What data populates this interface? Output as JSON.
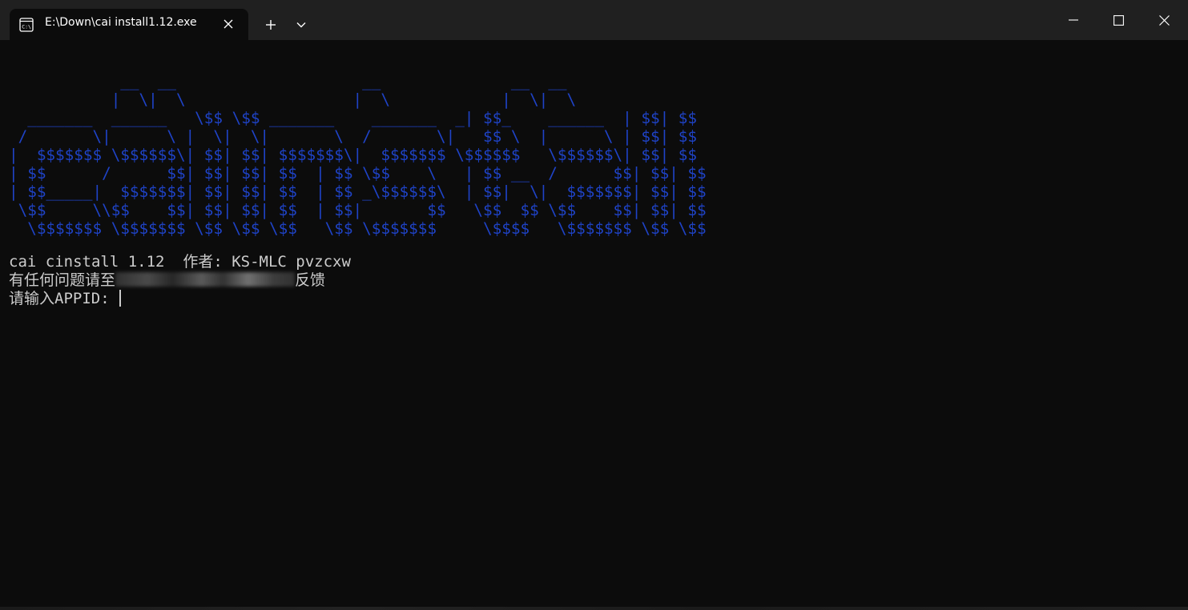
{
  "window": {
    "tab_title": "E:\\Down\\cai install1.12.exe",
    "tab_icon": "terminal-icon",
    "controls": {
      "new_tab": "plus-icon",
      "dropdown": "chevron-down-icon",
      "minimize": "minimize-icon",
      "maximize": "maximize-icon",
      "close": "close-icon"
    }
  },
  "terminal": {
    "banner_color": "#1f43c7",
    "text_color": "#cccccc",
    "background": "#0c0c0c",
    "banner_ascii": "            __  __                    __              __  __\n           |  \\|  \\                  |  \\            |  \\|  \\\n  _______  ______   \\$$ \\$$ _______    _______  _| $$_    ______  | $$| $$\n /       \\|      \\ |  \\|  \\|       \\  /       \\|   $$ \\  |      \\ | $$| $$\n|  $$$$$$$ \\$$$$$$\\| $$| $$| $$$$$$$\\|  $$$$$$$ \\$$$$$$   \\$$$$$$\\| $$| $$\n| $$      /      $$| $$| $$| $$  | $$ \\$$    \\   | $$ __  /      $$| $$| $$\n| $$_____|  $$$$$$$| $$| $$| $$  | $$ _\\$$$$$$\\  | $$|  \\|  $$$$$$$| $$| $$\n \\$$     \\\\$$    $$| $$| $$| $$  | $$|       $$   \\$$  $$ \\$$    $$| $$| $$\n  \\$$$$$$$ \\$$$$$$$ \\$$ \\$$ \\$$   \\$$ \\$$$$$$$     \\$$$$   \\$$$$$$$ \\$$ \\$$",
    "line1": "cai cinstall 1.12  作者: KS-MLC pvzcxw",
    "line2_prefix": "有任何问题请至",
    "line2_suffix": "反馈",
    "line3_prompt": "请输入APPID: "
  }
}
